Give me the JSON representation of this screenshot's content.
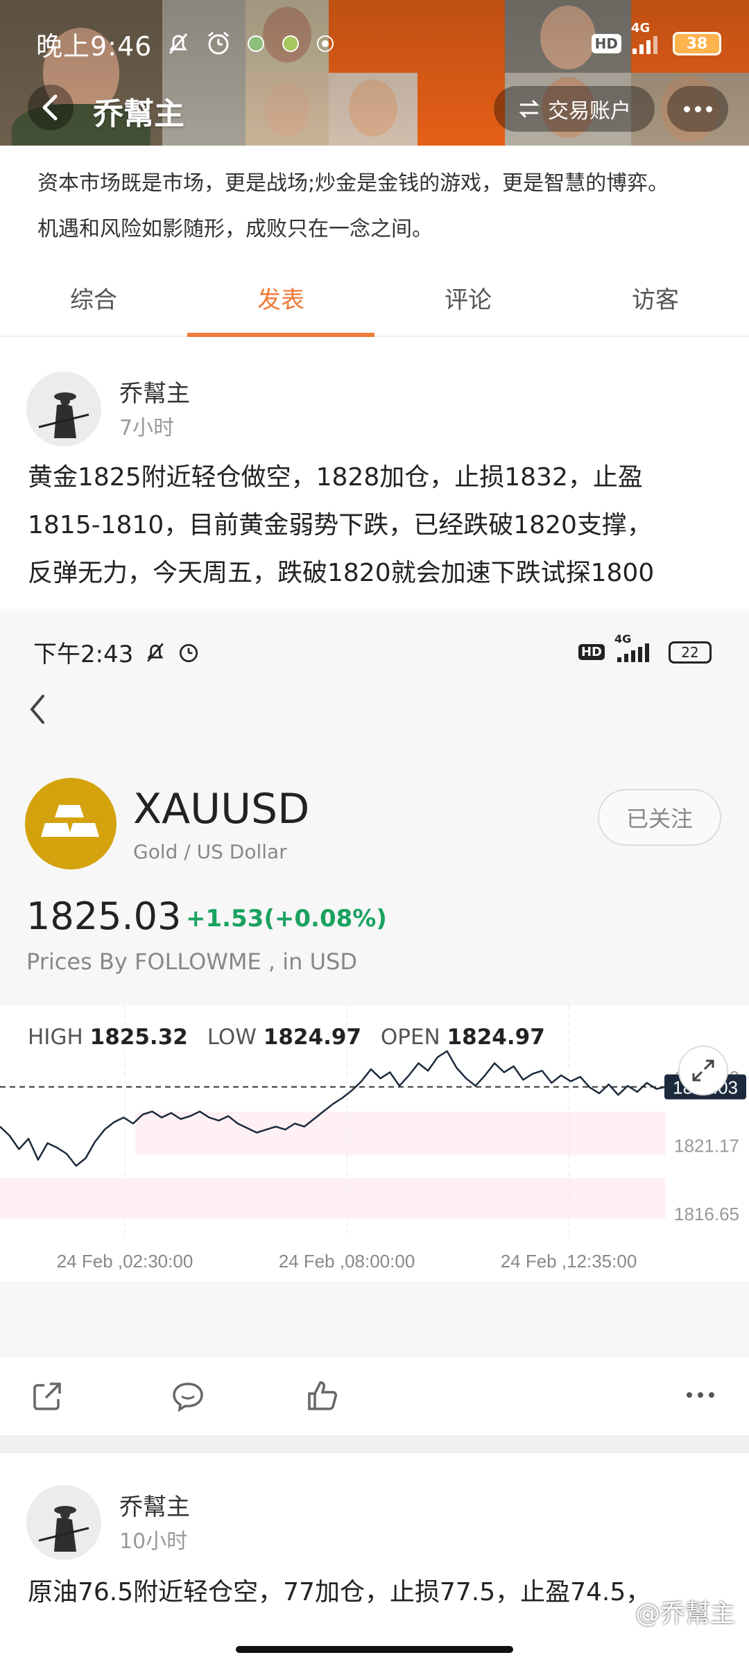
{
  "status_bar": {
    "time": "晚上9:46",
    "network": "4G",
    "battery": "38",
    "hd": "HD"
  },
  "header": {
    "title": "乔幫主",
    "account_button": "交易账户"
  },
  "bio": {
    "line1": "资本市场既是市场，更是战场;炒金是金钱的游戏，更是智慧的博弈。",
    "line2": "机遇和风险如影随形，成败只在一念之间。"
  },
  "tabs": [
    {
      "label": "综合",
      "active": false
    },
    {
      "label": "发表",
      "active": true
    },
    {
      "label": "评论",
      "active": false
    },
    {
      "label": "访客",
      "active": false
    }
  ],
  "post1": {
    "author": "乔幫主",
    "time": "7小时",
    "text_lines": [
      "黄金1825附近轻仓做空，1828加仓，止损1832，止盈",
      "1815-1810，目前黄金弱势下跌，已经跌破1820支撑，",
      "反弹无力，今天周五，跌破1820就会加速下跌试探1800"
    ]
  },
  "embed": {
    "status_time": "下午2:43",
    "network": "4G",
    "battery": "22",
    "hd": "HD",
    "symbol": "XAUUSD",
    "symbol_sub": "Gold / US Dollar",
    "follow_label": "已关注",
    "price": "1825.03",
    "change": "+1.53(+0.08%)",
    "source": "Prices By FOLLOWME , in USD",
    "high_label": "HIGH",
    "high": "1825.32",
    "low_label": "LOW",
    "low": "1824.97",
    "open_label": "OPEN",
    "open": "1824.97"
  },
  "chart_data": {
    "type": "line",
    "title": "",
    "xlabel": "",
    "ylabel": "",
    "x_ticks": [
      "24 Feb ,02:30:00",
      "24 Feb ,08:00:00",
      "24 Feb ,12:35:00"
    ],
    "y_ticks": [
      "1825.70",
      "1821.17",
      "1816.65"
    ],
    "y_tick_values": [
      1825.7,
      1821.17,
      1816.65
    ],
    "ylim": [
      1815.5,
      1828.6
    ],
    "current_price": 1825.03,
    "current_label": "1825.03",
    "series": [
      {
        "values": [
          1822.4,
          1821.8,
          1820.9,
          1821.6,
          1820.2,
          1821.3,
          1821.0,
          1820.6,
          1819.8,
          1820.3,
          1821.4,
          1822.2,
          1822.7,
          1823.0,
          1822.6,
          1823.2,
          1823.4,
          1823.0,
          1823.3,
          1822.9,
          1823.1,
          1823.4,
          1823.0,
          1822.8,
          1823.1,
          1822.6,
          1822.3,
          1822.0,
          1822.2,
          1822.4,
          1822.2,
          1822.6,
          1822.4,
          1822.9,
          1823.4,
          1823.9,
          1824.3,
          1824.8,
          1825.4,
          1826.2,
          1825.6,
          1826.0,
          1825.1,
          1825.8,
          1826.6,
          1826.1,
          1827.0,
          1827.4,
          1826.3,
          1825.6,
          1825.1,
          1825.8,
          1826.6,
          1826.0,
          1826.4,
          1825.5,
          1825.9,
          1826.1,
          1825.3,
          1825.8,
          1825.4,
          1825.7,
          1825.0,
          1824.6,
          1825.2,
          1824.5,
          1825.1,
          1824.7,
          1825.3,
          1824.9,
          1825.03
        ]
      }
    ]
  },
  "actions": {
    "share": "share-icon",
    "comment": "comment-icon",
    "like": "thumbs-up-icon",
    "more": "more-icon"
  },
  "post2": {
    "author": "乔幫主",
    "time": "10小时",
    "text_line": "原油76.5附近轻仓空，77加仓，止损77.5，止盈74.5，"
  },
  "watermark": "@乔幫主"
}
